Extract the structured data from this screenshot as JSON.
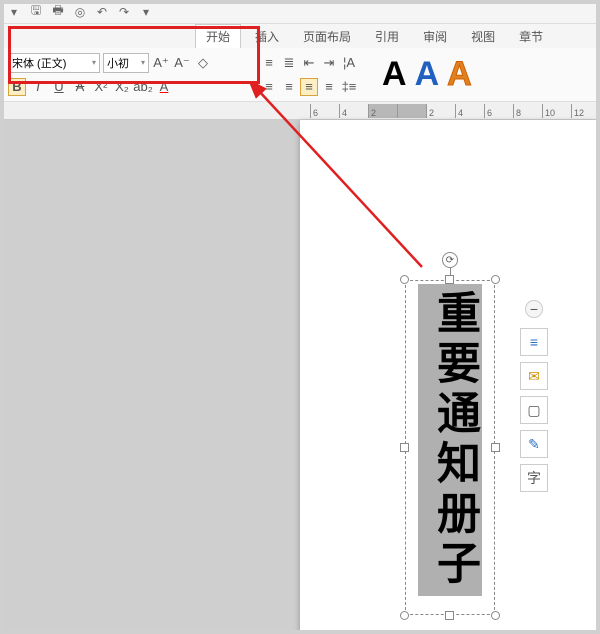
{
  "tabs": {
    "items": [
      "开始",
      "插入",
      "页面布局",
      "引用",
      "审阅",
      "视图",
      "章节"
    ],
    "active": "开始"
  },
  "font_group": {
    "font_name": "宋体 (正文)",
    "font_size": "小初",
    "grow": "A⁺",
    "shrink": "A⁻",
    "clear": "◇",
    "bold": "B",
    "italic": "I",
    "underline": "U",
    "strike": "A",
    "sup": "X²",
    "sub": "X₂",
    "abc": "ab₂",
    "color": "A"
  },
  "wordart": {
    "a1": "A",
    "a2": "A",
    "a3": "A"
  },
  "ruler": {
    "marks": [
      "6",
      "4",
      "2",
      "",
      "2",
      "4",
      "6",
      "8",
      "10",
      "12"
    ]
  },
  "textbox": {
    "text": "重要通知册子"
  },
  "side": {
    "minus": "−",
    "lines": "≡",
    "open": "✉",
    "rect": "▢",
    "pen": "✎",
    "char": "字"
  }
}
